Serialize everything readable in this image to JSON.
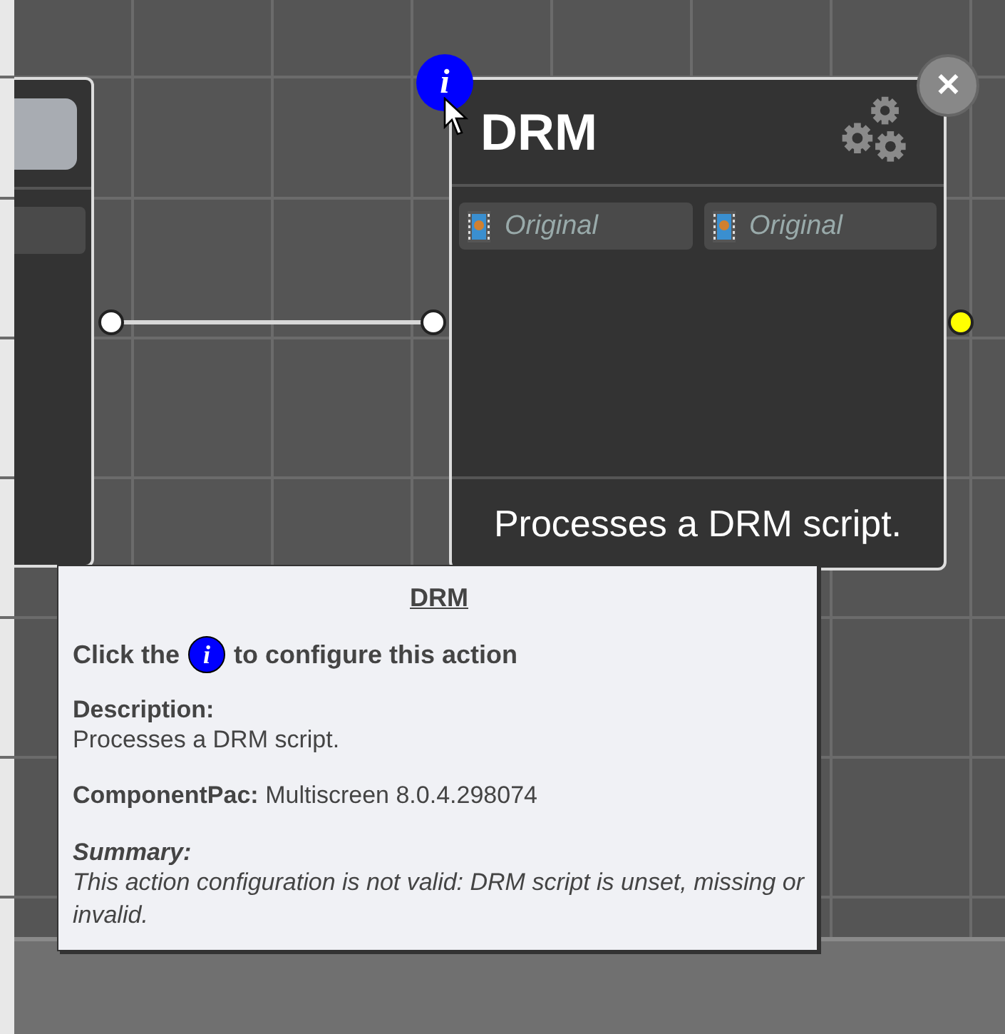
{
  "node": {
    "info_button": "i",
    "title": "DRM",
    "close_button": "✕",
    "inputs": [
      {
        "label": "Original"
      },
      {
        "label": "Original"
      }
    ],
    "description": "Processes a DRM script."
  },
  "ports": [
    {
      "color": "#ffffff"
    },
    {
      "color": "#ffffff"
    },
    {
      "color": "#ffff00"
    }
  ],
  "tooltip": {
    "title": "DRM",
    "hint_before": "Click the",
    "hint_icon": "i",
    "hint_after": "to configure this action",
    "description_label": "Description:",
    "description": "Processes a DRM script.",
    "component_label": "ComponentPac:",
    "component": "Multiscreen 8.0.4.298074",
    "summary_label": "Summary:",
    "summary": "This action configuration is not valid: DRM script is unset, missing or invalid."
  }
}
